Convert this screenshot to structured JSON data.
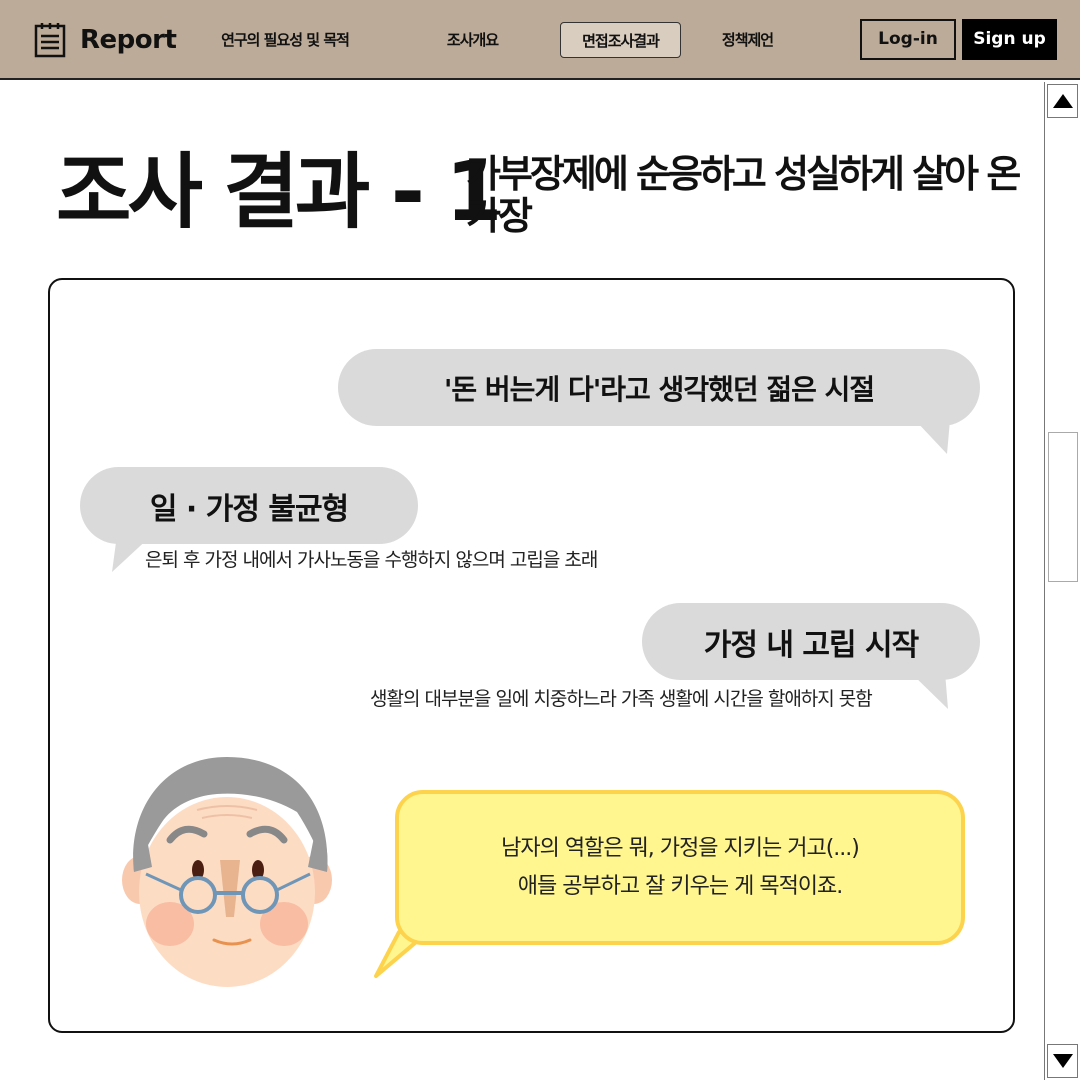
{
  "header": {
    "logo_text": "Report",
    "nav": [
      {
        "label": "연구의 필요성 및 목적"
      },
      {
        "label": "조사개요"
      },
      {
        "label": "면접조사결과"
      },
      {
        "label": "정책제언"
      }
    ],
    "login_label": "Log-in",
    "signup_label": "Sign up",
    "bg_color": "#bcab98"
  },
  "title": {
    "main": "조사 결과 - 1",
    "sub": "가부장제에 순응하고 성실하게 살아 온 가장"
  },
  "card": {
    "bubble1": "'돈 버는게 다'라고 생각했던 젊은 시절",
    "bubble2": "일 · 가정 불균형",
    "bubble2_desc": "은퇴 후 가정 내에서 가사노동을 수행하지 않으며 고립을 초래",
    "bubble3": "가정 내 고립 시작",
    "bubble3_desc": "생활의 대부분을 일에 치중하느라 가족 생활에 시간을 할애하지 못함",
    "quote_line1": "남자의 역할은 뭐, 가정을 지키는 거고(...)",
    "quote_line2": "애들 공부하고 잘 키우는 게 목적이죠.",
    "bubble_color": "#dadada",
    "quote_color": "#fff68f",
    "quote_border_color": "#fdd24d"
  },
  "icons": {
    "logo": "notepad-icon",
    "scroll_up": "triangle-up-icon",
    "scroll_down": "triangle-down-icon",
    "avatar": "elderly-man-face-icon"
  }
}
